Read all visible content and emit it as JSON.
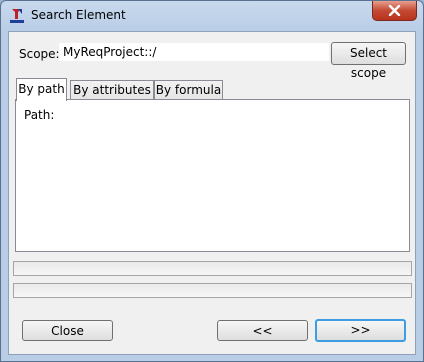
{
  "window": {
    "title": "Search Element",
    "icon": "requirement-app-icon"
  },
  "scope": {
    "label": "Scope:",
    "value": "MyReqProject::/",
    "select_label": "Select scope"
  },
  "tabs": [
    {
      "label": "By path",
      "active": true
    },
    {
      "label": "By attributes",
      "active": false
    },
    {
      "label": "By formula",
      "active": false
    }
  ],
  "panel": {
    "path_label": "Path:"
  },
  "buttons": {
    "close": "Close",
    "previous": "<<",
    "next": ">>"
  },
  "colors": {
    "focus_border": "#3c9de0",
    "close_red": "#c44a33"
  }
}
